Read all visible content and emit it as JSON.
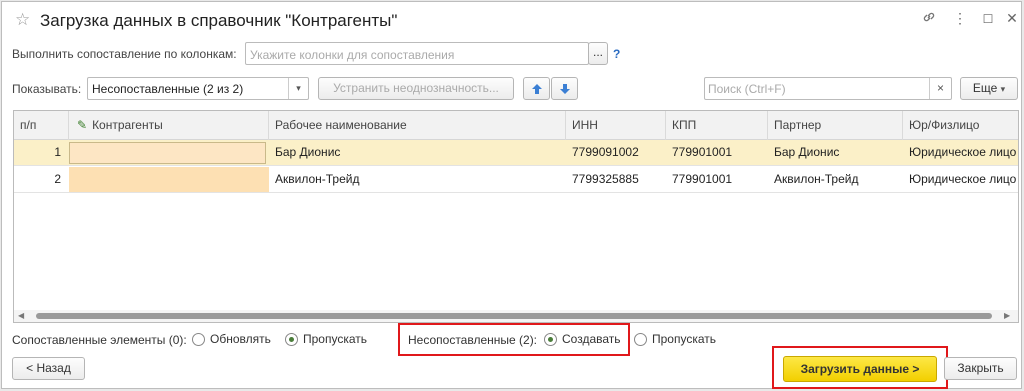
{
  "window": {
    "title": "Загрузка данных в справочник \"Контрагенты\"",
    "icons": [
      "star-icon",
      "link-icon",
      "more-icon",
      "maximize-icon",
      "close-icon"
    ]
  },
  "match": {
    "label": "Выполнить сопоставление по колонкам:",
    "placeholder": "Укажите колонки для сопоставления",
    "ellipsis": "...",
    "help": "?"
  },
  "filter": {
    "label": "Показывать:",
    "value": "Несопоставленные (2 из 2)",
    "resolve_label": "Устранить неоднозначность...",
    "search_placeholder": "Поиск (Ctrl+F)",
    "clear": "×",
    "more_label": "Еще"
  },
  "table": {
    "columns": [
      "п/п",
      "Контрагенты",
      "Рабочее наименование",
      "ИНН",
      "КПП",
      "Партнер",
      "Юр/Физлицо"
    ],
    "rows": [
      {
        "n": "1",
        "counterparty": "",
        "name": "Бар Дионис",
        "inn": "7799091002",
        "kpp": "779901001",
        "partner": "Бар Дионис",
        "type": "Юридическое лицо"
      },
      {
        "n": "2",
        "counterparty": "",
        "name": "Аквилон-Трейд",
        "inn": "7799325885",
        "kpp": "779901001",
        "partner": "Аквилон-Трейд",
        "type": "Юридическое лицо"
      }
    ]
  },
  "options": {
    "matched_label": "Сопоставленные элементы (0):",
    "update_label": "Обновлять",
    "skip_label": "Пропускать",
    "unmatched_label": "Несопоставленные (2):",
    "create_label": "Создавать",
    "skip2_label": "Пропускать"
  },
  "footer": {
    "back_label": "< Назад",
    "load_label": "Загрузить данные >",
    "close_label": "Закрыть"
  },
  "colors": {
    "accent_yellow": "#f5d60d",
    "highlight_red": "#e0181b",
    "selected_row": "#fbf0c8"
  }
}
